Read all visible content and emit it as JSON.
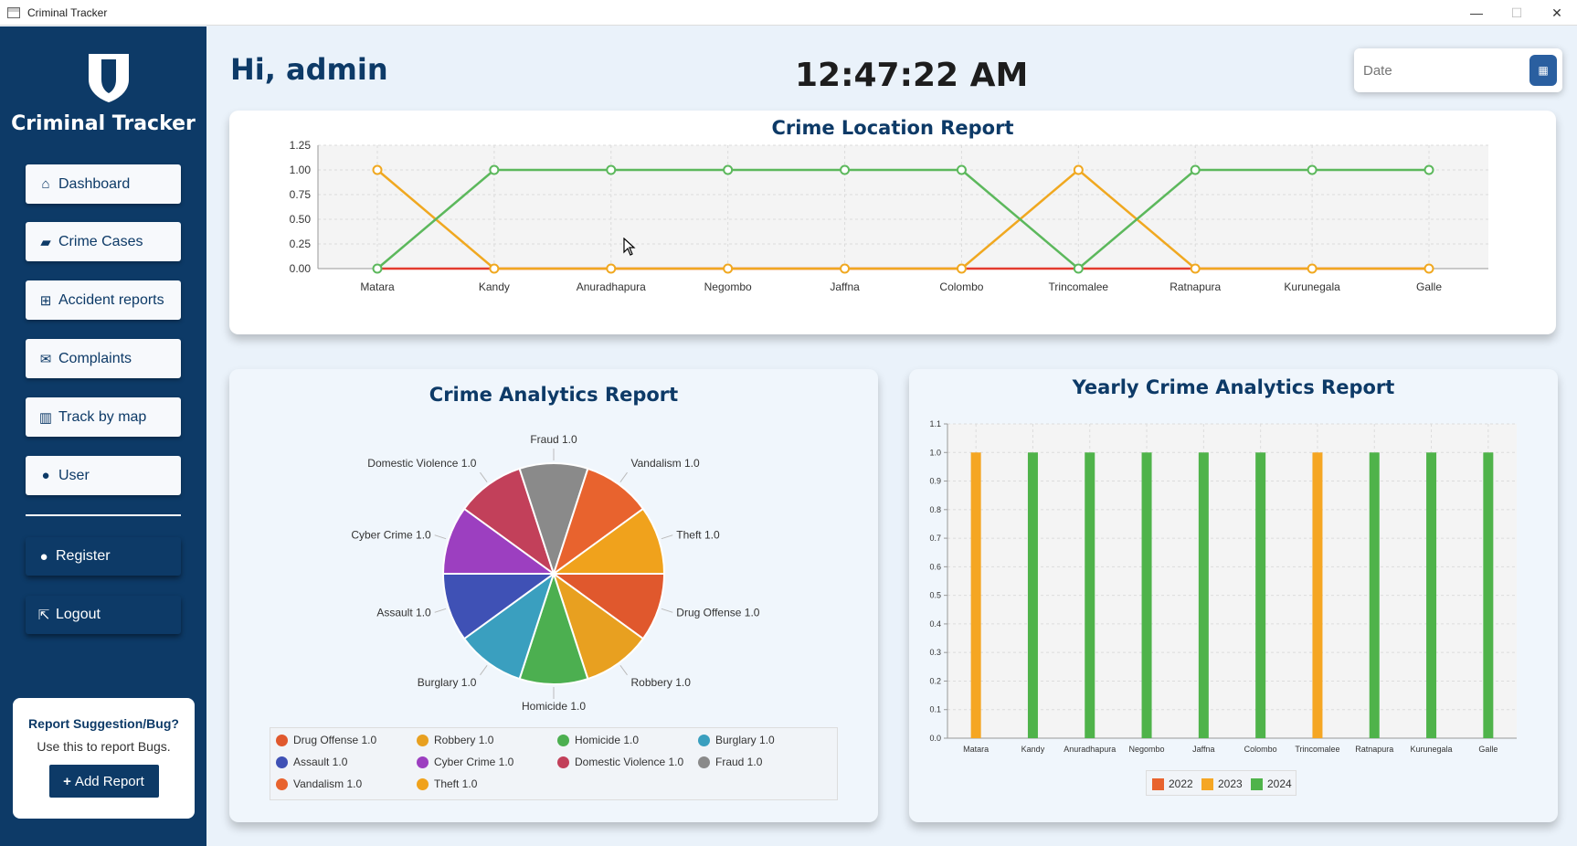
{
  "window": {
    "title": "Criminal Tracker",
    "minimize": "—",
    "maximize": "☐",
    "close": "✕"
  },
  "sidebar": {
    "brand": "Criminal Tracker",
    "nav": [
      {
        "label": "Dashboard",
        "icon": "home-icon"
      },
      {
        "label": "Crime Cases",
        "icon": "book-icon"
      },
      {
        "label": "Accident reports",
        "icon": "medkit-icon"
      },
      {
        "label": "Complaints",
        "icon": "envelope-icon"
      },
      {
        "label": "Track by map",
        "icon": "map-icon"
      },
      {
        "label": "User",
        "icon": "user-icon"
      }
    ],
    "register": "Register",
    "logout": "Logout",
    "report": {
      "title": "Report Suggestion/Bug?",
      "subtitle": "Use this to report Bugs.",
      "button": "Add Report"
    }
  },
  "header": {
    "greeting": "Hi, admin",
    "clock": "12:47:22 AM",
    "date_placeholder": "Date"
  },
  "colors": {
    "navy": "#0d3a67",
    "orange": "#e8852a",
    "gold": "#f0a820",
    "green": "#4fb34a",
    "red": "#d94a3a"
  },
  "chart_data": [
    {
      "type": "line",
      "title": "Crime Location Report",
      "categories": [
        "Matara",
        "Kandy",
        "Anuradhapura",
        "Negombo",
        "Jaffna",
        "Colombo",
        "Trincomalee",
        "Ratnapura",
        "Kurunegala",
        "Galle"
      ],
      "ylim": [
        0,
        1.25
      ],
      "yticks": [
        "0.00",
        "0.25",
        "0.50",
        "0.75",
        "1.00",
        "1.25"
      ],
      "grid": true,
      "series": [
        {
          "color": "#e33b2e",
          "values": [
            0,
            0,
            0,
            0,
            0,
            0,
            0,
            0,
            0,
            0
          ]
        },
        {
          "color": "#f0a820",
          "values": [
            1,
            0,
            0,
            0,
            0,
            0,
            1,
            0,
            0,
            0
          ]
        },
        {
          "color": "#5cb85c",
          "values": [
            0,
            1,
            1,
            1,
            1,
            1,
            0,
            1,
            1,
            1
          ]
        }
      ]
    },
    {
      "type": "pie",
      "title": "Crime Analytics Report",
      "slices": [
        {
          "label": "Drug Offense 1.0",
          "value": 1.0,
          "color": "#e0582d"
        },
        {
          "label": "Robbery 1.0",
          "value": 1.0,
          "color": "#e8a020"
        },
        {
          "label": "Homicide 1.0",
          "value": 1.0,
          "color": "#4caf50"
        },
        {
          "label": "Burglary 1.0",
          "value": 1.0,
          "color": "#3a9fbf"
        },
        {
          "label": "Assault 1.0",
          "value": 1.0,
          "color": "#3f51b5"
        },
        {
          "label": "Cyber Crime 1.0",
          "value": 1.0,
          "color": "#9c3fc0"
        },
        {
          "label": "Domestic Violence 1.0",
          "value": 1.0,
          "color": "#c2405a"
        },
        {
          "label": "Fraud 1.0",
          "value": 1.0,
          "color": "#8a8a8a"
        },
        {
          "label": "Vandalism 1.0",
          "value": 1.0,
          "color": "#e8632e"
        },
        {
          "label": "Theft 1.0",
          "value": 1.0,
          "color": "#f0a21c"
        }
      ],
      "legend": "bottom"
    },
    {
      "type": "bar",
      "title": "Yearly Crime Analytics Report",
      "categories": [
        "Matara",
        "Kandy",
        "Anuradhapura",
        "Negombo",
        "Jaffna",
        "Colombo",
        "Trincomalee",
        "Ratnapura",
        "Kurunegala",
        "Galle"
      ],
      "ylim": [
        0,
        1.1
      ],
      "yticks": [
        "0.0",
        "0.1",
        "0.2",
        "0.3",
        "0.4",
        "0.5",
        "0.6",
        "0.7",
        "0.8",
        "0.9",
        "1.0",
        "1.1"
      ],
      "series": [
        {
          "name": "2022",
          "color": "#e8632e",
          "values": [
            0,
            0,
            0,
            0,
            0,
            0,
            0,
            0,
            0,
            0
          ]
        },
        {
          "name": "2023",
          "color": "#f5a623",
          "values": [
            1,
            0,
            0,
            0,
            0,
            0,
            1,
            0,
            0,
            0
          ]
        },
        {
          "name": "2024",
          "color": "#4fb34a",
          "values": [
            0,
            1,
            1,
            1,
            1,
            1,
            0,
            1,
            1,
            1
          ]
        }
      ],
      "legend": "bottom"
    }
  ]
}
